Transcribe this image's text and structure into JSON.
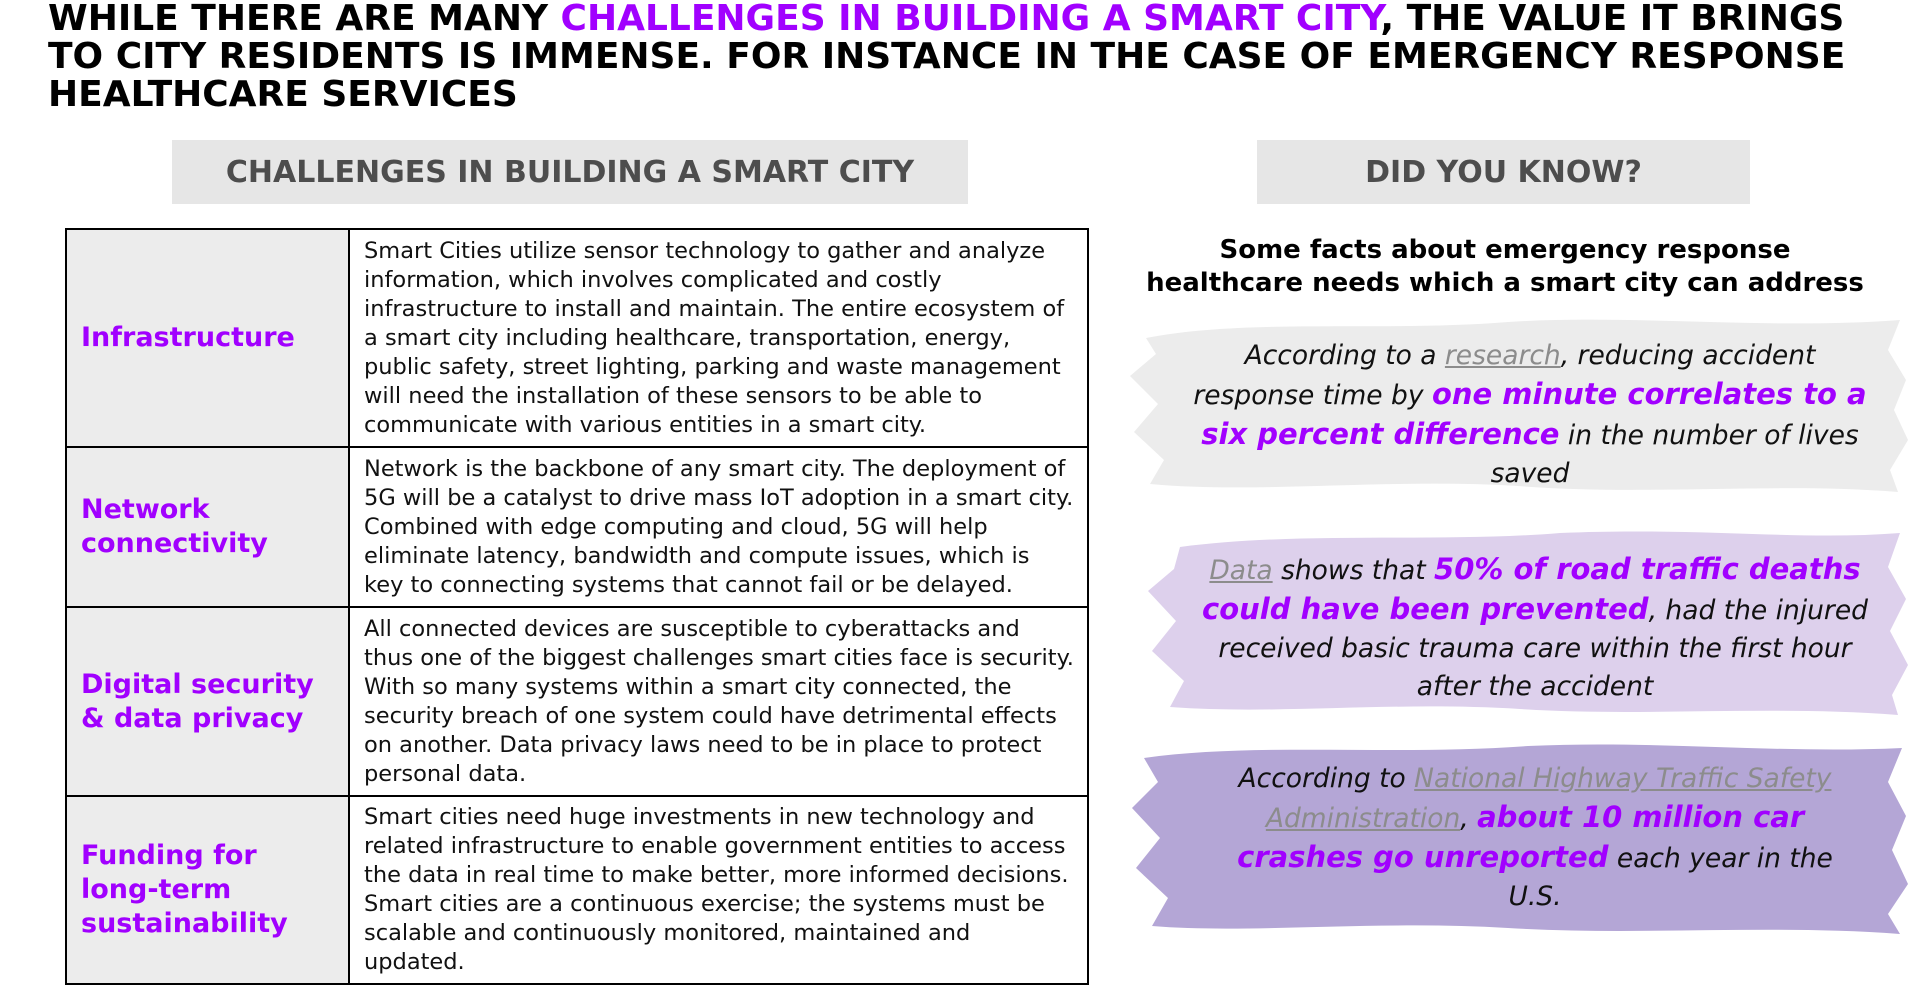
{
  "headline": {
    "part1": "WHILE THERE ARE MANY ",
    "highlight": "CHALLENGES IN BUILDING A SMART CITY",
    "part2": ", THE VALUE IT BRINGS TO CITY RESIDENTS IS IMMENSE. FOR INSTANCE IN THE CASE OF EMERGENCY RESPONSE HEALTHCARE SERVICES"
  },
  "challenges_header": "CHALLENGES IN BUILDING A SMART CITY",
  "did_you_know_header": "DID YOU KNOW?",
  "challenges": [
    {
      "label": "Infrastructure",
      "description": "Smart Cities utilize sensor technology to gather and analyze information, which involves complicated and costly infrastructure to install and maintain. The entire ecosystem of a smart city including healthcare, transportation, energy, public safety, street lighting, parking and waste management will need the installation of these sensors to be able to communicate with various entities in a smart city."
    },
    {
      "label": "Network connectivity",
      "description": "Network is the backbone of any smart city. The deployment of 5G will be a catalyst to drive mass IoT adoption in a smart city. Combined with edge computing and cloud, 5G will help eliminate latency, bandwidth and compute issues, which is key to connecting systems that cannot fail or be delayed."
    },
    {
      "label": "Digital security & data privacy",
      "description": "All connected devices are susceptible to cyberattacks and thus one of the biggest challenges smart cities face is security. With so many systems within a smart city connected, the security breach of one system could have detrimental effects on another. Data privacy laws need to be in place to protect personal data."
    },
    {
      "label": "Funding for long-term sustainability",
      "description": "Smart cities need huge investments in new technology and related infrastructure to enable government entities to access the data in real time to make better, more informed decisions. Smart cities are a continuous exercise; the systems must be scalable and continuously monitored, maintained and updated."
    }
  ],
  "facts_intro": "Some facts about emergency response healthcare needs which a smart city can address",
  "facts": [
    {
      "pre": "According to a ",
      "link": "research",
      "mid": ", reducing accident response time by ",
      "emphasis": "one minute correlates to a six percent difference",
      "post": " in the number of lives saved"
    },
    {
      "pre": " ",
      "link": "Data",
      "mid": " shows that ",
      "emphasis": "50% of road traffic deaths could have been prevented",
      "post": ", had the injured received basic trauma care within the first hour after the accident"
    },
    {
      "pre": "According to ",
      "link": "National Highway Traffic Safety Administration",
      "mid": ", ",
      "emphasis": "about 10 million car crashes go unreported",
      "post": " each year in the U.S."
    }
  ],
  "colors": {
    "accent": "#a100ff",
    "fact1_brush": "#ececec",
    "fact2_brush": "#ddd0ec",
    "fact3_brush": "#b4a6d6"
  }
}
